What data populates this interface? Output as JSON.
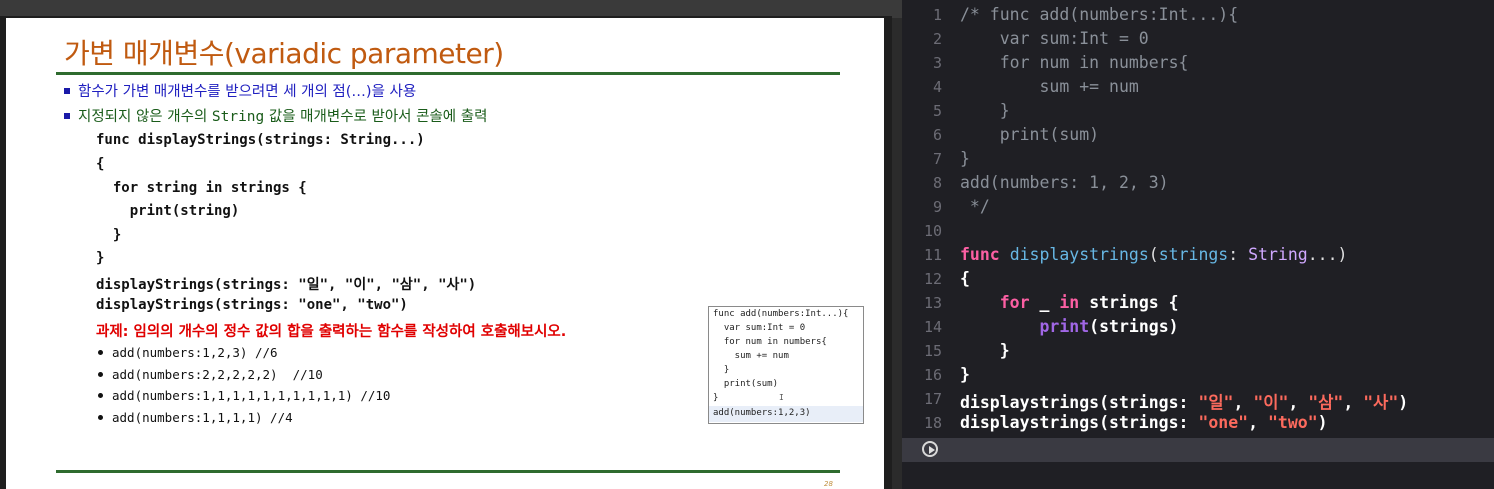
{
  "slide": {
    "title": "가변 매개변수(variadic parameter)",
    "bullets": [
      "함수가 가변 매개변수를 받으려면 세 개의 점(…)을 사용",
      {
        "before": "지정되지 않은 개수의 ",
        "code": "String",
        "after": " 값을 매개변수로 받아서 콘솔에 출력"
      }
    ],
    "code_lines": [
      "func displayStrings(strings: String...)",
      "{",
      "  for string in strings {",
      "    print(string)",
      "  }",
      "}",
      "displayStrings(strings: \"일\", \"이\", \"삼\", \"사\")",
      "displayStrings(strings: \"one\", \"two\")"
    ],
    "task": "과제: 임의의 개수의 정수 값의 합을 출력하는 함수를 작성하여 호출해보시오.",
    "examples": [
      "add(numbers:1,2,3) //6",
      "add(numbers:2,2,2,2,2)  //10",
      "add(numbers:1,1,1,1,1,1,1,1,1,1) //10",
      "add(numbers:1,1,1,1) //4"
    ],
    "page_number": "28",
    "inset_lines": [
      "func add(numbers:Int...){",
      "  var sum:Int = 0",
      "  for num in numbers{",
      "    sum += num",
      "  }",
      "  print(sum)",
      "}",
      "add(numbers:1,2,3)"
    ]
  },
  "editor": {
    "line_numbers": [
      "1",
      "2",
      "3",
      "4",
      "5",
      "6",
      "7",
      "8",
      "9",
      "10",
      "11",
      "12",
      "13",
      "14",
      "15",
      "16",
      "17",
      "18"
    ],
    "comment_lines": [
      "/* func add(numbers:Int...){",
      "    var sum:Int = 0",
      "    for num in numbers{",
      "        sum += num",
      "    }",
      "    print(sum)",
      "}",
      "add(numbers: 1, 2, 3)",
      " */"
    ],
    "tokens": {
      "func_kw": "func",
      "func_name": "displaystrings",
      "param": "strings",
      "type": "String",
      "variadic": "...)",
      "open_brace": "{",
      "for_kw": "for",
      "underscore": "_",
      "in_kw": "in",
      "seq": "strings {",
      "print_fn": "print",
      "print_arg": "(strings)",
      "close_inner": "}",
      "close_outer": "}",
      "call_name": "displaystrings(strings: ",
      "str_il": "\"일\"",
      "str_i": "\"이\"",
      "str_sam": "\"삼\"",
      "str_sa": "\"사\"",
      "str_one": "\"one\"",
      "str_two": "\"two\""
    }
  },
  "colors": {
    "title": "#c05a10",
    "rule": "#2e6b2e",
    "task": "#e00000",
    "keyword": "#fc5fa3",
    "function": "#67b7e4",
    "type": "#d0a8ff",
    "string": "#fc6a5d",
    "editor_bg": "#1f1f24"
  },
  "icons": {
    "run": "play-circle-icon"
  }
}
